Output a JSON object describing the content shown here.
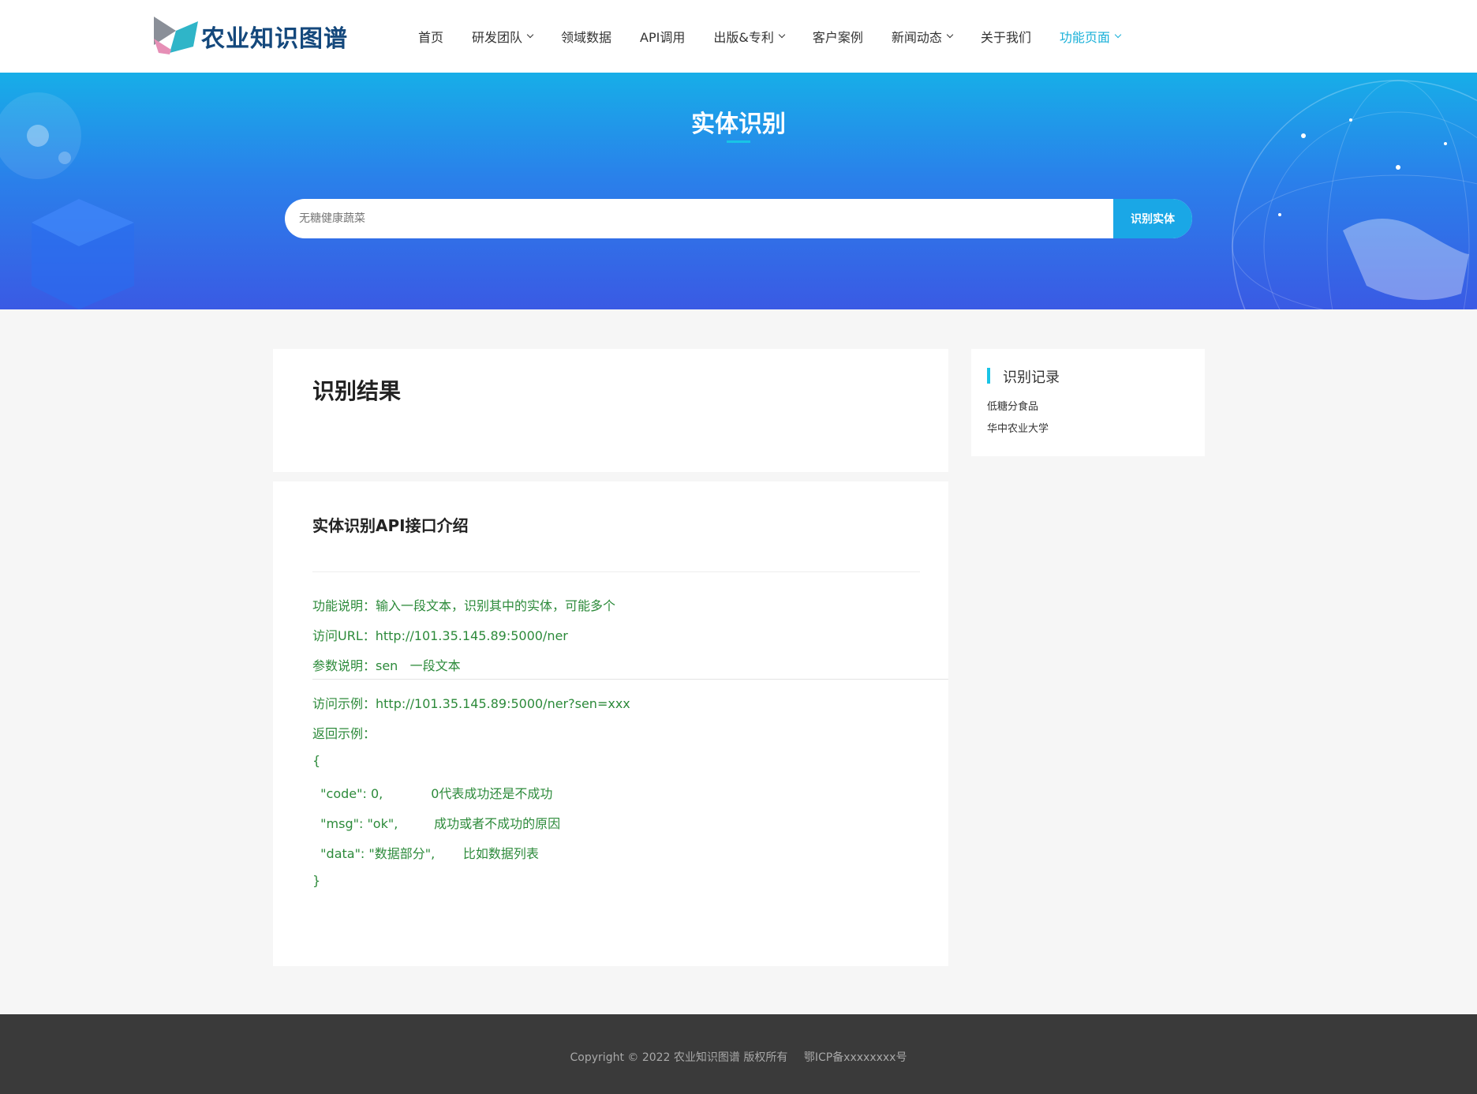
{
  "header": {
    "logo_text": "农业知识图谱",
    "nav": [
      {
        "label": "首页",
        "dropdown": false,
        "active": false
      },
      {
        "label": "研发团队",
        "dropdown": true,
        "active": false
      },
      {
        "label": "领域数据",
        "dropdown": false,
        "active": false
      },
      {
        "label": "API调用",
        "dropdown": false,
        "active": false
      },
      {
        "label": "出版&专利",
        "dropdown": true,
        "active": false
      },
      {
        "label": "客户案例",
        "dropdown": false,
        "active": false
      },
      {
        "label": "新闻动态",
        "dropdown": true,
        "active": false
      },
      {
        "label": "关于我们",
        "dropdown": false,
        "active": false
      },
      {
        "label": "功能页面",
        "dropdown": true,
        "active": true
      }
    ]
  },
  "banner": {
    "title": "实体识别",
    "search_placeholder": "无糖健康蔬菜",
    "search_button": "识别实体"
  },
  "result": {
    "title": "识别结果"
  },
  "api": {
    "title": "实体识别API接口介绍",
    "lines": [
      "功能说明：输入一段文本，识别其中的实体，可能多个",
      "访问URL：http://101.35.145.89:5000/ner",
      "参数说明：sen   一段文本",
      "访问示例：http://101.35.145.89:5000/ner?sen=xxx",
      "返回示例：",
      "{",
      "  \"code\": 0,            0代表成功还是不成功",
      "  \"msg\": \"ok\",         成功或者不成功的原因",
      "  \"data\": \"数据部分\",       比如数据列表",
      "}"
    ]
  },
  "sidebar": {
    "title": "识别记录",
    "items": [
      "低糖分食品",
      "华中农业大学"
    ]
  },
  "footer": {
    "copyright": "Copyright © 2022 农业知识图谱 版权所有",
    "icp": "鄂ICP备xxxxxxxx号"
  },
  "colors": {
    "accent": "#19c4e6",
    "nav_active": "#18b0d8",
    "api_text": "#2c8a3a",
    "footer_bg": "#3a3a3a"
  }
}
